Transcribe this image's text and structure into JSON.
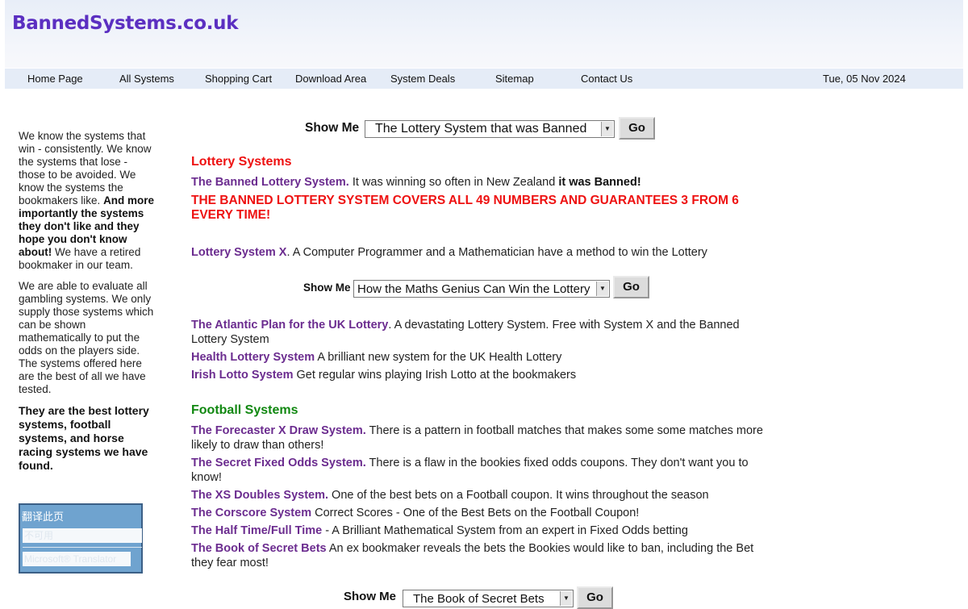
{
  "site": {
    "logo": "BannedSystems.co.uk"
  },
  "nav": {
    "items": [
      "Home Page",
      "All Systems",
      "Shopping Cart",
      "Download Area",
      "System Deals",
      "Sitemap",
      "Contact Us"
    ],
    "date": "Tue, 05 Nov 2024"
  },
  "sidebar": {
    "p1_a": "We know the systems that win - consistently. We know the systems that lose - those to be avoided. We know the systems the bookmakers like.",
    "p1_b": "And more importantly the systems they don't like and they hope you don't know about!",
    "p1_c": "We have a retired bookmaker in our team.",
    "p2": "We are able to evaluate all gambling systems. We only supply those systems which can be shown mathematically to put the odds on the players side. The systems offered here are the best of all we have tested.",
    "p3": "They are the best lottery systems, football systems, and horse racing systems we have found.",
    "translator": {
      "title": "翻译此页",
      "row1": "不可用",
      "row2": "Microsoft® Translator"
    }
  },
  "showme": {
    "label": "Show Me",
    "go": "Go",
    "selects": [
      "The Lottery System that was Banned",
      "How the Maths Genius Can Win the Lottery",
      "The Book of Secret Bets"
    ]
  },
  "lottery": {
    "title": "Lottery Systems",
    "banned_link": "The Banned Lottery System.",
    "banned_text": " It was winning so often in New Zealand ",
    "banned_bold": "it was Banned!",
    "alert": "THE BANNED LOTTERY SYSTEM COVERS ALL 49 NUMBERS AND GUARANTEES 3 FROM 6 EVERY TIME!",
    "x_link": "Lottery System X",
    "x_text": ". A Computer Programmer and a Mathematician have a method to win the Lottery",
    "atlantic_link": "The Atlantic Plan for the UK Lottery",
    "atlantic_text": ". A devastating Lottery System. Free with System X and the Banned Lottery System",
    "health_link": "Health Lottery System",
    "health_text": " A brilliant new system for the UK Health Lottery",
    "irish_link": "Irish Lotto System",
    "irish_text": " Get regular wins playing Irish Lotto at the bookmakers"
  },
  "football": {
    "title": "Football Systems",
    "forecaster_link": "The Forecaster X Draw System.",
    "forecaster_text": " There is a pattern in football matches that makes some some matches more likely to draw than others!",
    "fixed_link": "The Secret Fixed Odds System.",
    "fixed_text": " There is a flaw in the bookies fixed odds coupons. They don't want you to know!",
    "xs_link": "The XS Doubles System.",
    "xs_text": " One of the best bets on a Football coupon. It wins throughout the season",
    "corscore_link": "The Corscore System",
    "corscore_text": " Correct Scores - One of the Best Bets on the Football Coupon!",
    "htft_link": "The Half Time/Full Time",
    "htft_text": " - A Brilliant Mathematical System from an expert in Fixed Odds betting",
    "book_link": "The Book of Secret Bets",
    "book_text": " An ex bookmaker reveals the bets the Bookies would like to ban, including the Bet they fear most!"
  },
  "colors": {
    "lottery_title": "#ee1111",
    "football_title": "#118811",
    "link": "#6b2c8f",
    "logo": "#5b2fc1"
  }
}
